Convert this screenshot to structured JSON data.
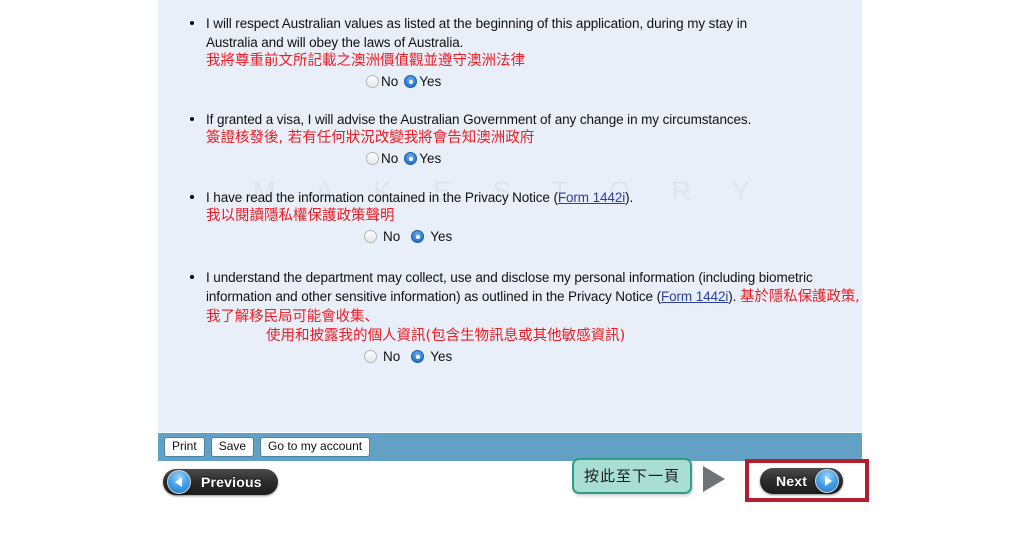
{
  "watermark": {
    "text": "M A K E   S T O R Y"
  },
  "declarations": [
    {
      "id": "australian-values",
      "en_line1": "I will respect Australian values as listed at the beginning of this application, during my stay in",
      "en_line2": "Australia and will obey the laws of Australia.",
      "zh": "我將尊重前文所記載之澳洲價值觀並遵守澳洲法律",
      "options": {
        "no": "No",
        "yes": "Yes"
      },
      "selected": "yes"
    },
    {
      "id": "advise-change",
      "en_line1": "If granted a visa, I will advise the Australian Government of any change in my circumstances.",
      "zh": "簽證核發後, 若有任何狀況改變我將會告知澳洲政府",
      "options": {
        "no": "No",
        "yes": "Yes"
      },
      "selected": "yes"
    },
    {
      "id": "privacy-notice-read",
      "en_prefix": "I have read the information contained in the Privacy Notice (",
      "en_link": "Form 1442i",
      "en_suffix": ").",
      "zh": "我以閱讀隱私權保護政策聲明",
      "options": {
        "no": "No",
        "yes": "Yes"
      },
      "selected": "yes"
    },
    {
      "id": "collect-use-disclose",
      "en_prefix": "I understand the department may collect, use and disclose my personal information (including biometric information and other sensitive information) as outlined in the Privacy Notice (",
      "en_link": "Form 1442i",
      "en_suffix": "). ",
      "zh_line1": "基於隱私保護政策, 我了解移民局可能會收集、",
      "zh_line2": "使用和披露我的個人資訊(包含生物訊息或其他敏感資訊)",
      "options": {
        "no": "No",
        "yes": "Yes"
      },
      "selected": "yes"
    }
  ],
  "toolbar": {
    "print_label": "Print",
    "save_label": "Save",
    "account_label": "Go to my account"
  },
  "navigation": {
    "previous_label": "Previous",
    "next_label": "Next"
  },
  "annotation": {
    "text": "按此至下一頁"
  },
  "colors": {
    "panel_background": "#e9eff8",
    "toolbar_blue": "#62a0c4",
    "chinese_red": "#ee1c25",
    "link_blue": "#2b3f9e",
    "radio_selected": "#2f7fd4",
    "annotation_fill": "#a9ded5",
    "annotation_border": "#2f9e86",
    "highlight_red": "#b31f2c",
    "arrow_gray": "#6e7475"
  }
}
